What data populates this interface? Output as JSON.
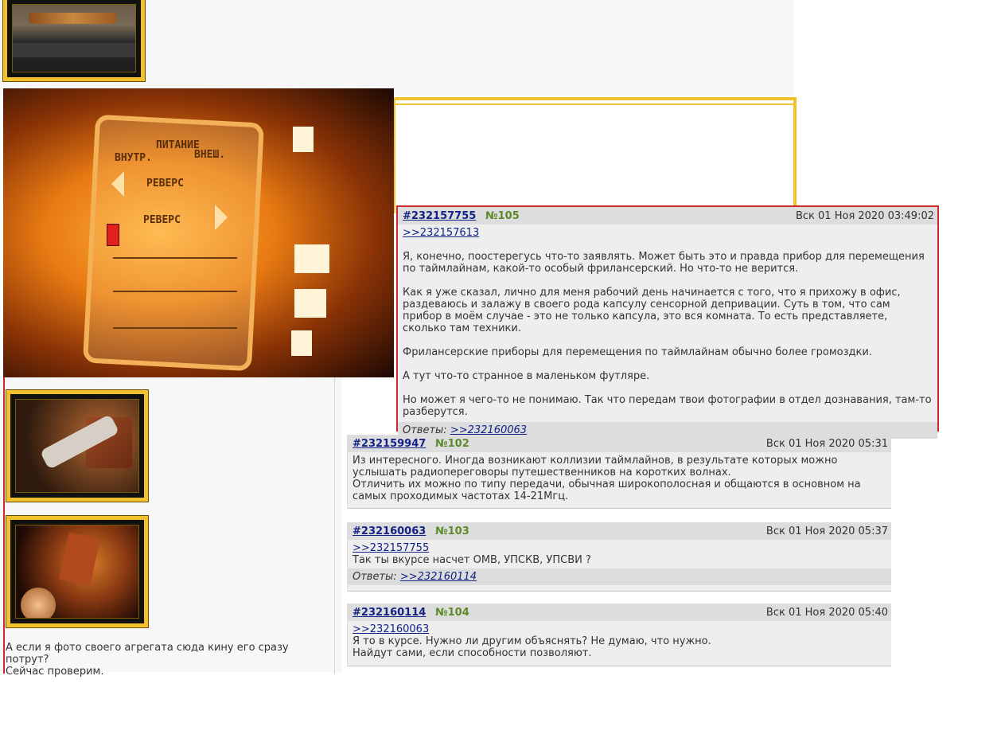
{
  "posts": {
    "p105": {
      "id": "#232157755",
      "num": "№105",
      "date": "Вск 01 Ноя 2020 03:49:02",
      "reply_to": ">>232157613",
      "paragraphs": [
        "Я, конечно, поостерегусь что-то заявлять. Может быть это и правда прибор для перемещения по таймлайнам, какой-то особый фрилансерский. Но что-то не верится.",
        "Как я уже сказал, лично для меня рабочий день начинается с того, что я прихожу в офис, раздеваюсь и залажу в своего рода капсулу сенсорной депривации. Суть в том, что сам прибор в моём случае - это не только капсула, это вся комната. То есть представляете, сколько там техники.",
        "Фрилансерские приборы для перемещения по таймлайнам обычно более громоздки.",
        "А тут что-то странное в маленьком футляре.",
        "Но может я чего-то не понимаю. Так что передам твои фотографии в отдел дознавания, там-то разберутся."
      ],
      "replies_label": "Ответы:",
      "replies_link": ">>232160063"
    },
    "p102": {
      "id": "#232159947",
      "num": "№102",
      "date": "Вск 01 Ноя 2020 05:31",
      "line1": "Из интересного. Иногда возникают коллизии таймлайнов, в результате которых можно услышать радиопереговоры путешественников на коротких волнах.",
      "line2": "Отличить их можно по типу передачи, обычная широкополосная и общаются в основном на самых проходимых частотах 14-21Мгц."
    },
    "p103": {
      "id": "#232160063",
      "num": "№103",
      "date": "Вск 01 Ноя 2020 05:37",
      "reply_to": ">>232157755",
      "line1": "Так ты вкурсе насчет ОМВ, УПСКВ, УПСВИ ?",
      "replies_label": "Ответы:",
      "replies_link": ">>232160114"
    },
    "p104": {
      "id": "#232160114",
      "num": "№104",
      "date": "Вск 01 Ноя 2020 05:40",
      "reply_to": ">>232160063",
      "line1": "Я то в курсе. Нужно ли другим объяснять? Не думаю, что нужно.",
      "line2": "Найдут сами, если способности позволяют."
    }
  },
  "left_post": {
    "line1": "А если я фото своего агрегата сюда кину его сразу потрут?",
    "line2": "Сейчас проверим."
  },
  "photo_labels": {
    "vnutr": "ВНУТР.",
    "pitanie": "ПИТАНИЕ",
    "vnesh": "ВНЕШ.",
    "revers1": "РЕВЕРС",
    "revers2": "РЕВЕРС"
  },
  "colors": {
    "frame_yellow": "#f2c12e",
    "post_border_red": "#cc2b2b",
    "link_blue": "#112288",
    "post_number_green": "#5c8a2a"
  }
}
